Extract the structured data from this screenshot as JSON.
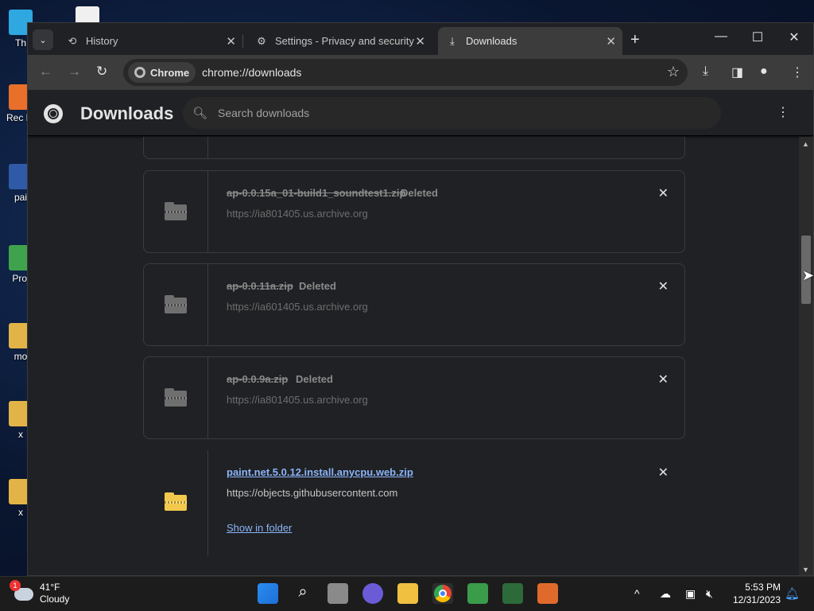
{
  "desktop": {
    "icons": [
      {
        "label": "Th"
      },
      {
        "label": "Rec Lau"
      },
      {
        "label": "pai"
      },
      {
        "label": "Proj"
      },
      {
        "label": "mo"
      },
      {
        "label": "x"
      },
      {
        "label": "x"
      }
    ]
  },
  "browser": {
    "tabs": [
      {
        "label": "History",
        "icon": "history-icon"
      },
      {
        "label": "Settings - Privacy and security",
        "icon": "gear-icon"
      },
      {
        "label": "Downloads",
        "icon": "download-icon"
      }
    ],
    "omnibox": {
      "chip": "Chrome",
      "url": "chrome://downloads"
    }
  },
  "downloads": {
    "title": "Downloads",
    "search_placeholder": "Search downloads",
    "items": [
      {
        "file": "ap-0.0.15a_01-build1_soundtest1.zip",
        "status": "Deleted",
        "source": "https://ia801405.us.archive.org"
      },
      {
        "file": "ap-0.0.11a.zip",
        "status": "Deleted",
        "source": "https://ia601405.us.archive.org"
      },
      {
        "file": "ap-0.0.9a.zip",
        "status": "Deleted",
        "source": "https://ia801405.us.archive.org"
      },
      {
        "file": "paint.net.5.0.12.install.anycpu.web.zip",
        "status": "",
        "source": "https://objects.githubusercontent.com",
        "action": "Show in folder"
      }
    ]
  },
  "taskbar": {
    "weather": {
      "temp": "41°F",
      "condition": "Cloudy",
      "badge": "1"
    },
    "clock": {
      "time": "5:53 PM",
      "date": "12/31/2023"
    }
  },
  "colors": {
    "accent_link": "#8ab4f8",
    "page_bg": "#202124"
  }
}
